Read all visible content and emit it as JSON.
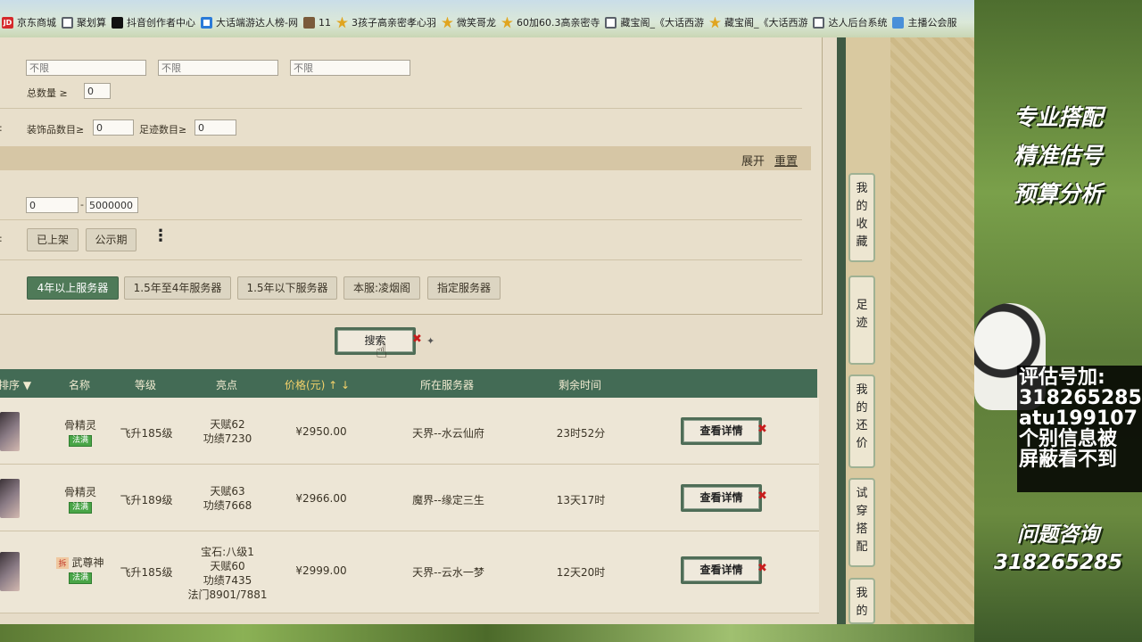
{
  "bookmarks": [
    {
      "label": "京东商城",
      "icon": "jd-icon"
    },
    {
      "label": "聚划算",
      "icon": "globe-icon"
    },
    {
      "label": "抖音创作者中心",
      "icon": "tiktok-icon"
    },
    {
      "label": "大话端游达人榜-网",
      "icon": "c-icon"
    },
    {
      "label": "11",
      "icon": "image-icon"
    },
    {
      "label": "3孩子高亲密孝心羽",
      "icon": "star-icon"
    },
    {
      "label": "微笑哥龙",
      "icon": "star-icon"
    },
    {
      "label": "60加60.3高亲密寺",
      "icon": "star-icon"
    },
    {
      "label": "藏宝阁_《大话西游",
      "icon": "globe-icon"
    },
    {
      "label": "藏宝阁_《大话西游",
      "icon": "star-icon"
    },
    {
      "label": "达人后台系统",
      "icon": "globe-icon"
    },
    {
      "label": "主播公会服",
      "icon": "blue-icon"
    }
  ],
  "filters": {
    "row1_placeholders": [
      "不限",
      "不限",
      "不限"
    ],
    "total_label": "总数量 ≥",
    "total_value": "0",
    "colon1": ":",
    "accessory_label": "装饰品数目≥",
    "accessory_value": "0",
    "footprint_label": "足迹数目≥",
    "footprint_value": "0",
    "expand_label": "展开",
    "reset_label": "重置",
    "price_min": "0",
    "price_sep": "-",
    "price_max": "5000000",
    "colon2": ":",
    "status_buttons": [
      "已上架",
      "公示期"
    ],
    "more_label": "⋮",
    "server_buttons": [
      "4年以上服务器",
      "1.5年至4年服务器",
      "1.5年以下服务器",
      "本服:凌烟阁",
      "指定服务器"
    ]
  },
  "search": {
    "label": "搜索"
  },
  "table": {
    "headers": {
      "sort": "排序 ▼",
      "name": "名称",
      "level": "等级",
      "highlight": "亮点",
      "price": "价格(元) ↑ ↓",
      "server": "所在服务器",
      "remaining": "剩余时间"
    },
    "rows": [
      {
        "name": "骨精灵",
        "sect": "法满",
        "tag": "",
        "level": "飞升185级",
        "highlights": [
          "天赋62",
          "功绩7230"
        ],
        "price": "¥2950.00",
        "server": "天界--水云仙府",
        "remaining": "23时52分",
        "action": "查看详情"
      },
      {
        "name": "骨精灵",
        "sect": "法满",
        "tag": "",
        "level": "飞升189级",
        "highlights": [
          "天赋63",
          "功绩7668"
        ],
        "price": "¥2966.00",
        "server": "魔界--缘定三生",
        "remaining": "13天17时",
        "action": "查看详情"
      },
      {
        "name": "武尊神",
        "sect": "法满",
        "tag": "拆",
        "level": "飞升185级",
        "highlights": [
          "宝石:八级1",
          "天赋60",
          "功绩7435",
          "法门8901/7881"
        ],
        "price": "¥2999.00",
        "server": "天界--云水一梦",
        "remaining": "12天20时",
        "action": "查看详情"
      }
    ]
  },
  "side_tabs": [
    {
      "label": "我的收藏",
      "chars": [
        "我",
        "的",
        "收",
        "藏"
      ]
    },
    {
      "label": "足迹",
      "chars": [
        "足",
        "迹"
      ]
    },
    {
      "label": "我的还价",
      "chars": [
        "我",
        "的",
        "还",
        "价"
      ]
    },
    {
      "label": "试穿搭配",
      "chars": [
        "试",
        "穿",
        "搭",
        "配"
      ]
    },
    {
      "label": "我的",
      "chars": [
        "我",
        "的"
      ]
    }
  ],
  "overlay": {
    "slogans": [
      "专业搭配",
      "精准估号",
      "预算分析"
    ],
    "contact_lines": [
      "评估号加:",
      "318265285",
      "atu199107",
      "个别信息被",
      "屏蔽看不到"
    ],
    "consult_label": "问题咨询",
    "consult_number": "318265285"
  },
  "colors": {
    "header_green": "#436b55",
    "active_button": "#4f7a58",
    "price_header": "#f3d16a",
    "close_red": "#c81d1d"
  }
}
